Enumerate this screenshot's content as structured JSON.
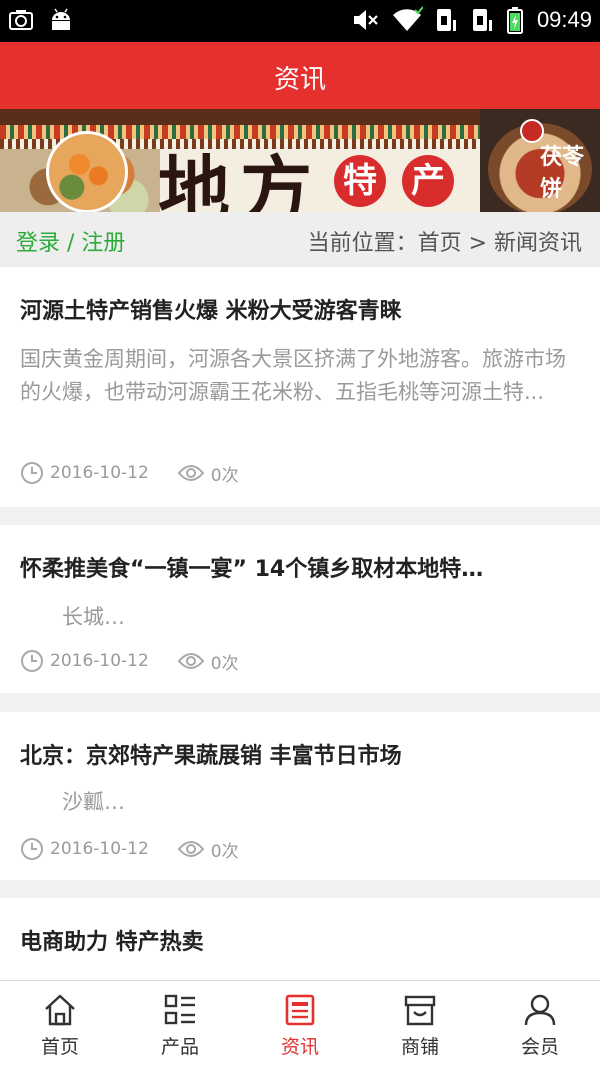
{
  "status_bar": {
    "time": "09:49"
  },
  "header": {
    "title": "资讯"
  },
  "banner": {
    "chars": [
      "地",
      "方",
      "特",
      "产"
    ],
    "brand": "茯苓饼"
  },
  "breadcrumb": {
    "auth": "登录 / 注册",
    "location": "当前位置：首页 > 新闻资讯"
  },
  "articles": [
    {
      "title": "河源土特产销售火爆 米粉大受游客青睐",
      "summary": "国庆黄金周期间，河源各大景区挤满了外地游客。旅游市场的火爆，也带动河源霸王花米粉、五指毛桃等河源土特...",
      "date": "2016-10-12",
      "views": "0次"
    },
    {
      "title": "怀柔推美食“一镇一宴” 14个镇乡取材本地特…",
      "summary": "　　长城…",
      "date": "2016-10-12",
      "views": "0次"
    },
    {
      "title": "北京：京郊特产果蔬展销 丰富节日市场",
      "summary": "　　沙瓤…",
      "date": "2016-10-12",
      "views": "0次"
    },
    {
      "title": "电商助力 特产热卖",
      "summary": "",
      "date": "",
      "views": ""
    }
  ],
  "nav": [
    {
      "label": "首页",
      "icon": "home-icon"
    },
    {
      "label": "产品",
      "icon": "list-icon"
    },
    {
      "label": "资讯",
      "icon": "news-icon"
    },
    {
      "label": "商铺",
      "icon": "shop-icon"
    },
    {
      "label": "会员",
      "icon": "user-icon"
    }
  ],
  "active_nav": "资讯",
  "colors": {
    "primary": "#e5302e",
    "link_green": "#2cab3a",
    "muted": "#9a9a9a"
  }
}
